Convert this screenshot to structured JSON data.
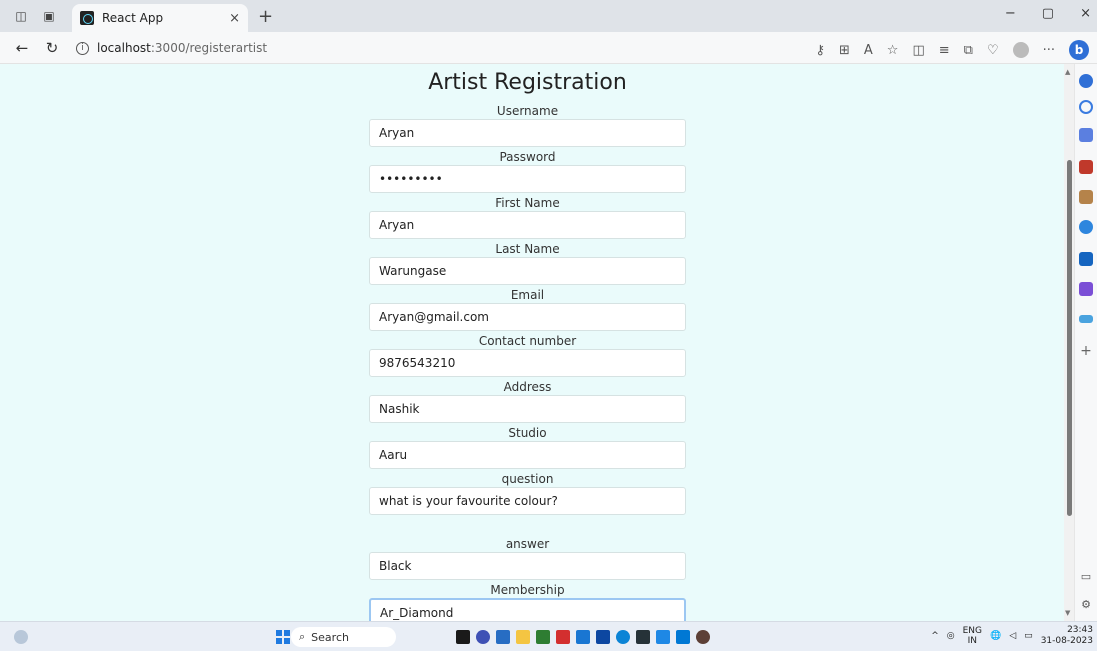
{
  "browser": {
    "tab_title": "React App",
    "tab_close": "×",
    "new_tab": "+",
    "url_host": "localhost",
    "url_path": ":3000/registerartist",
    "info": "i",
    "minimize": "−",
    "restore": "▢",
    "close": "×",
    "more": "···",
    "bing": "b"
  },
  "form": {
    "title": "Artist Registration",
    "fields": [
      {
        "label": "Username",
        "value": "Aryan"
      },
      {
        "label": "Password",
        "value": "•••••••••"
      },
      {
        "label": "First Name",
        "value": "Aryan"
      },
      {
        "label": "Last Name",
        "value": "Warungase"
      },
      {
        "label": "Email",
        "value": "Aryan@gmail.com"
      },
      {
        "label": "Contact number",
        "value": "9876543210"
      },
      {
        "label": "Address",
        "value": "Nashik"
      },
      {
        "label": "Studio",
        "value": "Aaru"
      },
      {
        "label": "question",
        "value": "what is your favourite colour?"
      },
      {
        "label": "answer",
        "value": "Black"
      },
      {
        "label": "Membership",
        "value": "Ar_Diamond"
      }
    ]
  },
  "taskbar": {
    "search_label": "Search",
    "lang_top": "ENG",
    "lang_bottom": "IN",
    "time": "23:43",
    "date": "31-08-2023"
  },
  "colors": {
    "page_bg": "#eafbfb",
    "input_border": "#d6e2e2",
    "focus_border": "#9cc7f2",
    "accent": "#1f7ae0"
  }
}
